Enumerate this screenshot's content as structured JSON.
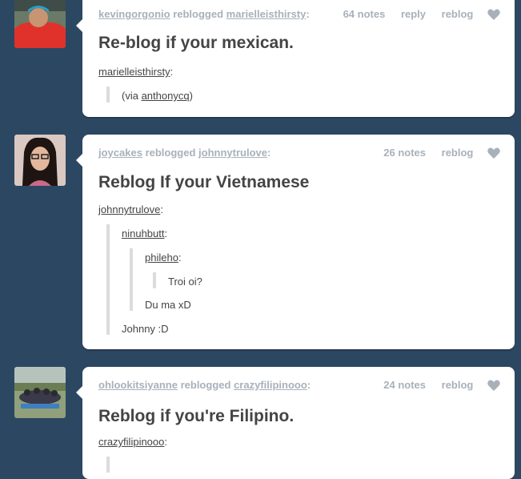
{
  "colors": {
    "background": "#2c4762",
    "card": "#ffffff",
    "meta": "#a8b1ba",
    "text": "#444444",
    "quote_bar": "#dcdcdc"
  },
  "posts": [
    {
      "avatar": "avatar-red-shirt-guy",
      "user": "kevingorgonio",
      "action": "reblogged",
      "source": "marielleisthirsty",
      "notes": "64 notes",
      "reply": "reply",
      "reblog": "reblog",
      "title": "Re-blog if your mexican.",
      "body_user": "marielleisthirsty",
      "via_text": "(via",
      "via_user": "anthonycq",
      "via_close": ")"
    },
    {
      "avatar": "avatar-girl-glasses",
      "user": "joycakes",
      "action": "reblogged",
      "source": "johnnytrulove",
      "notes": "26 notes",
      "reblog": "reblog",
      "title": "Reblog If your Vietnamese",
      "body_user": "johnnytrulove",
      "q1_user": "ninuhbutt",
      "q2_user": "phileho",
      "q3_text": "Troi oi?",
      "q2_text": "Du ma xD",
      "q1_text": "Johnny :D"
    },
    {
      "avatar": "avatar-group-photo",
      "user": "ohlookitsiyanne",
      "action": "reblogged",
      "source": "crazyfilipinooo",
      "notes": "24 notes",
      "reblog": "reblog",
      "title": "Reblog if you're Filipino.",
      "body_user": "crazyfilipinooo"
    }
  ]
}
